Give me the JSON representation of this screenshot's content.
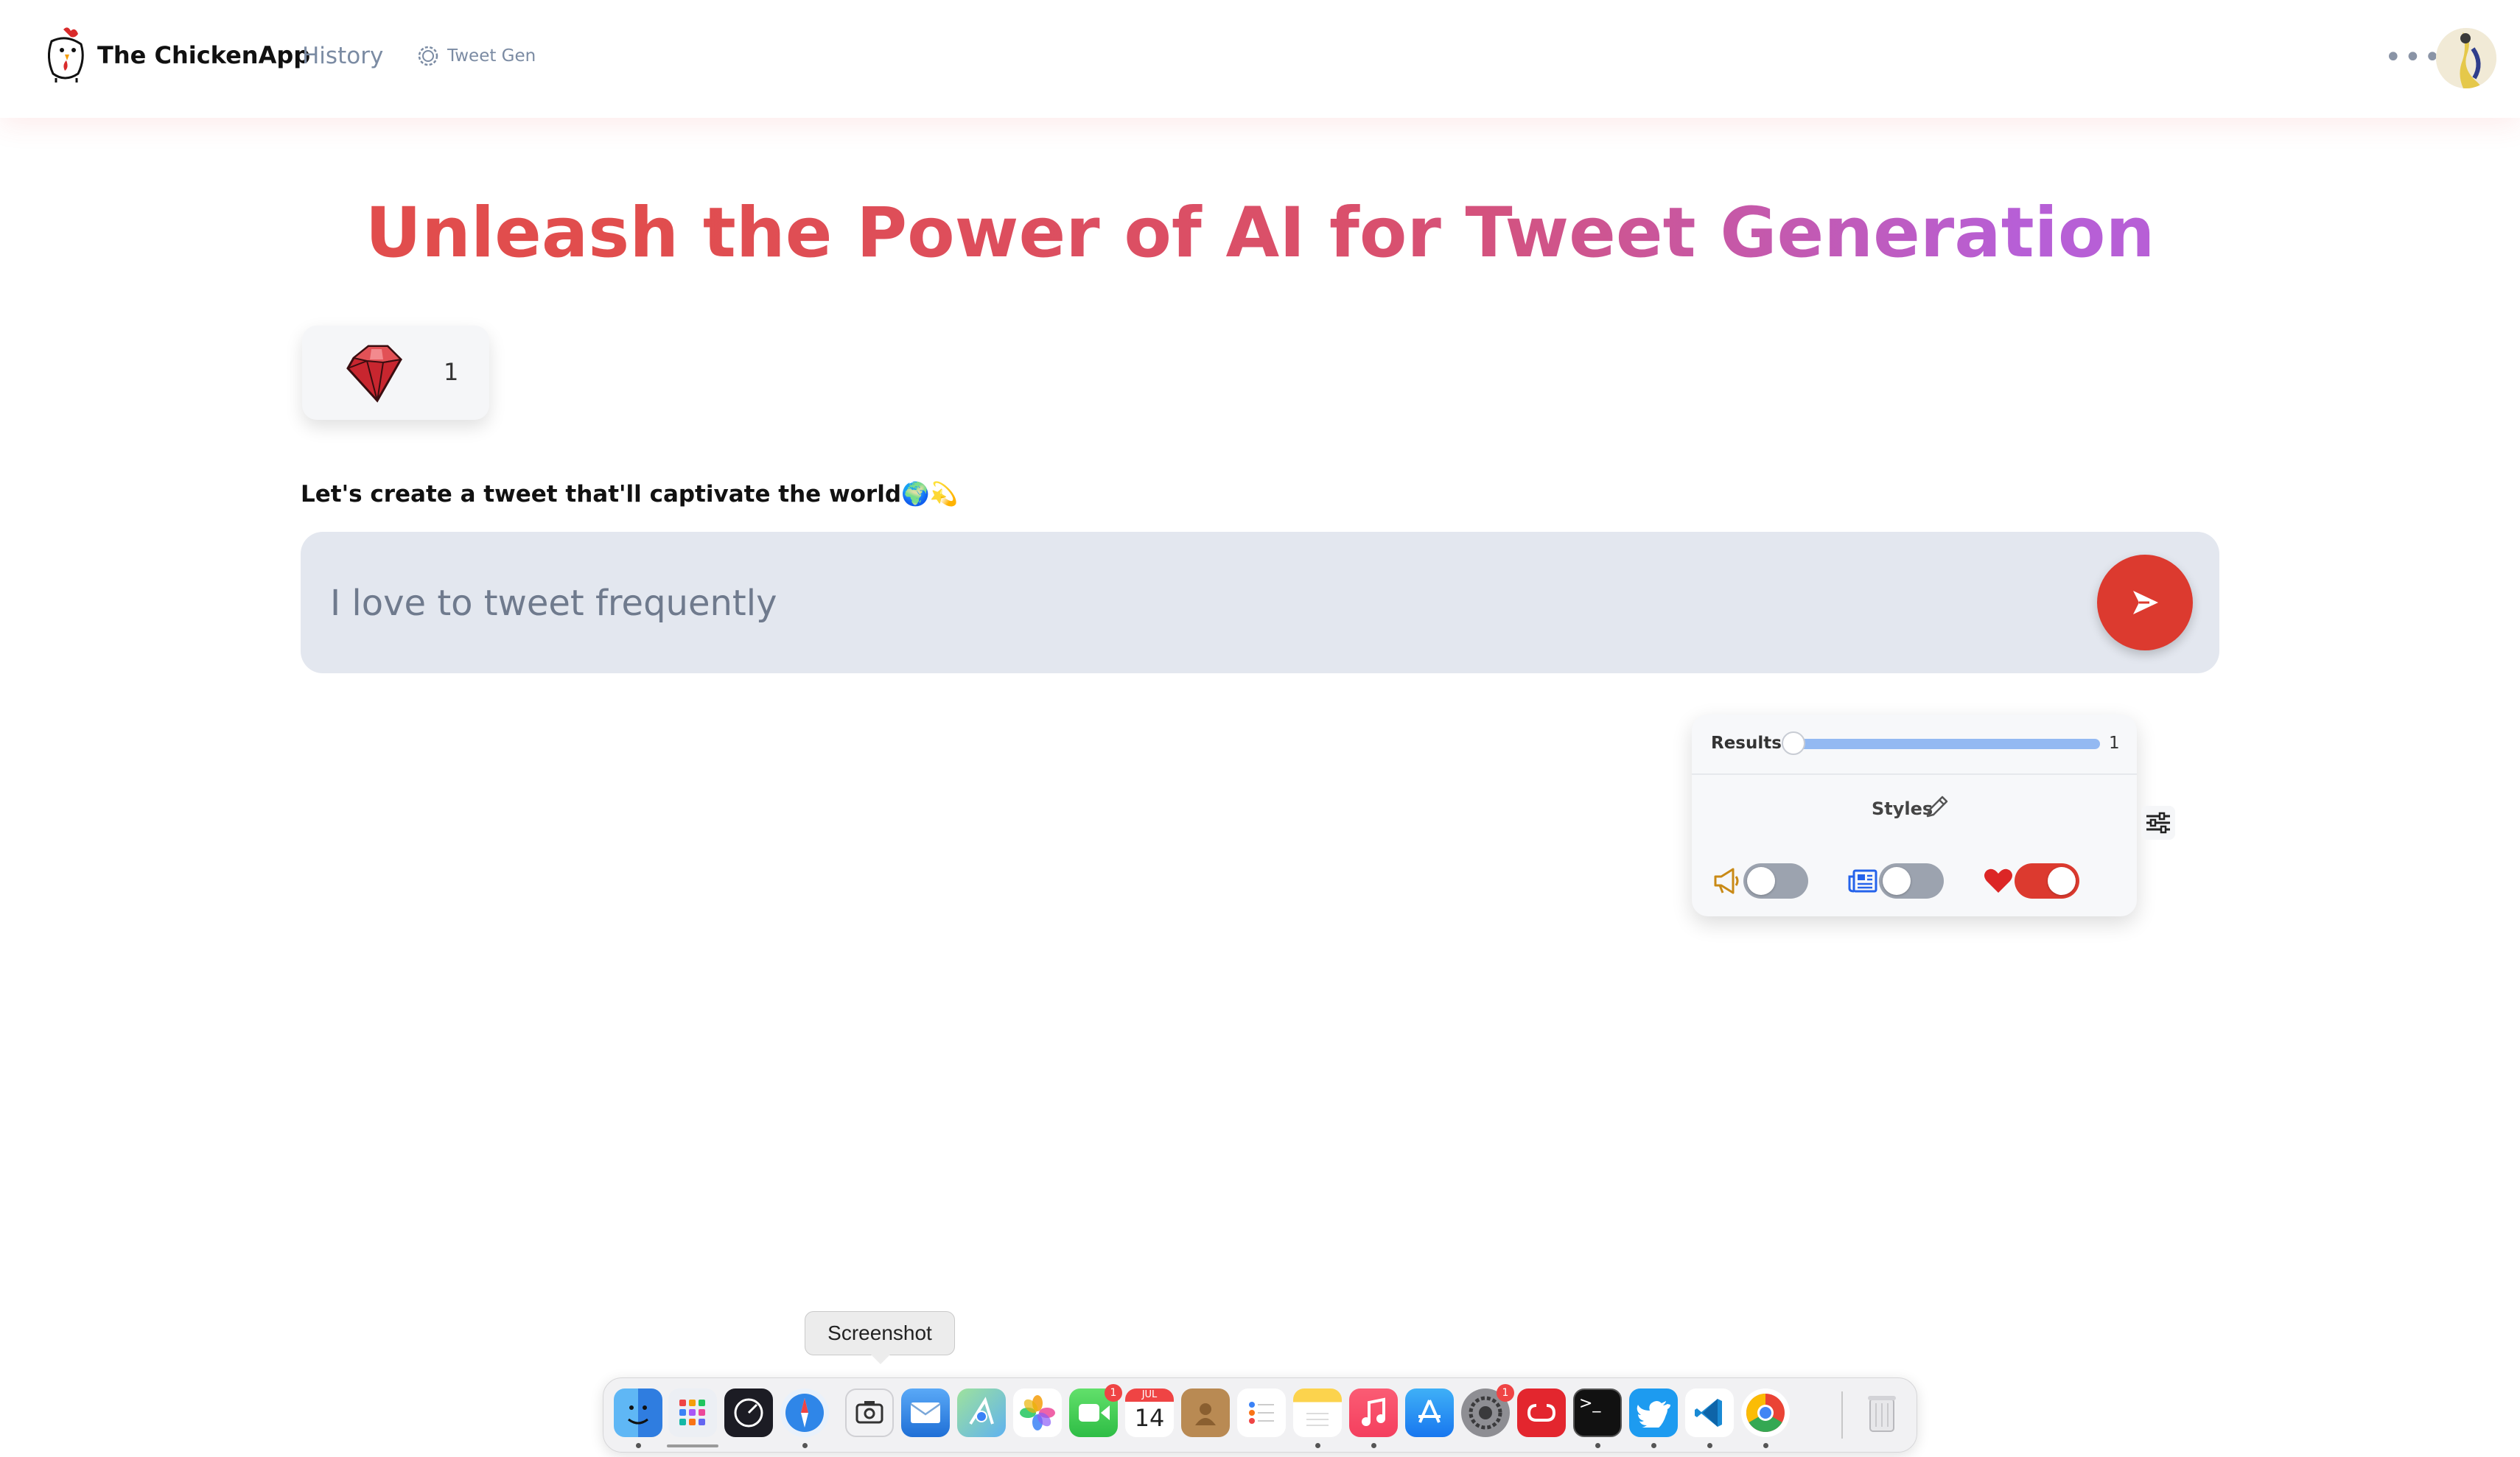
{
  "header": {
    "brand": "The ChickenApp",
    "nav_history": "History",
    "nav_tweet_gen": "Tweet Gen"
  },
  "main": {
    "title": "Unleash the Power of AI for Tweet Generation",
    "credits": "1",
    "prompt_label": "Let's create a tweet that'll captivate the world🌍💫",
    "prompt_placeholder": "I love to tweet frequently"
  },
  "settings": {
    "results_label": "Results:",
    "results_value": "1",
    "styles_label": "Styles",
    "toggles": [
      {
        "name": "promotional",
        "icon": "megaphone-icon",
        "on": false
      },
      {
        "name": "news",
        "icon": "newspaper-icon",
        "on": false
      },
      {
        "name": "heartfelt",
        "icon": "heart-icon",
        "on": true
      }
    ]
  },
  "dock": {
    "tooltip": "Screenshot",
    "apps": [
      {
        "name": "finder-icon",
        "running": true
      },
      {
        "name": "launchpad-icon",
        "running": false
      },
      {
        "name": "activity-monitor-icon",
        "running": false
      },
      {
        "name": "safari-icon",
        "running": true
      },
      {
        "name": "screenshot-icon",
        "running": false
      },
      {
        "name": "mail-icon",
        "running": false
      },
      {
        "name": "maps-icon",
        "running": false
      },
      {
        "name": "photos-icon",
        "running": false
      },
      {
        "name": "facetime-icon",
        "running": false,
        "badge": "1"
      },
      {
        "name": "calendar-icon",
        "running": false,
        "month": "JUL",
        "day": "14"
      },
      {
        "name": "contacts-icon",
        "running": false
      },
      {
        "name": "reminders-icon",
        "running": false
      },
      {
        "name": "notes-icon",
        "running": true
      },
      {
        "name": "music-icon",
        "running": true
      },
      {
        "name": "app-store-icon",
        "running": false
      },
      {
        "name": "system-settings-icon",
        "running": false,
        "badge": "1"
      },
      {
        "name": "creative-cloud-icon",
        "running": false
      },
      {
        "name": "terminal-icon",
        "running": true
      },
      {
        "name": "twitter-icon",
        "running": true
      },
      {
        "name": "vscode-icon",
        "running": true
      },
      {
        "name": "chrome-icon",
        "running": true
      },
      {
        "name": "trash-icon",
        "running": false
      }
    ]
  }
}
